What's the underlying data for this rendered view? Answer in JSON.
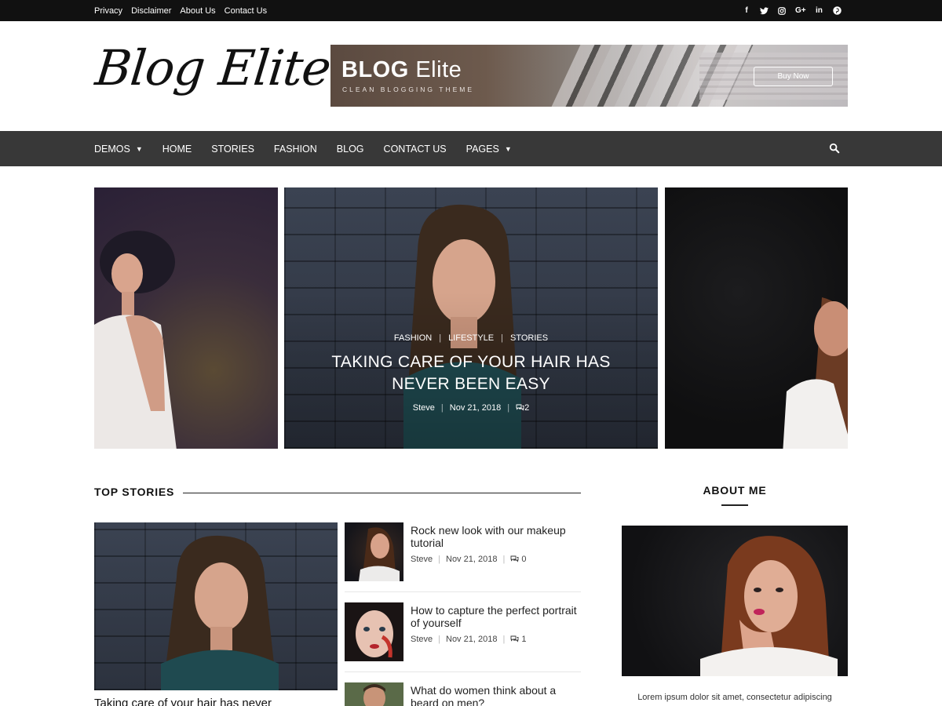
{
  "topbar": {
    "links": [
      "Privacy",
      "Disclaimer",
      "About Us",
      "Contact Us"
    ],
    "social_icons": [
      "facebook-icon",
      "twitter-icon",
      "instagram-icon",
      "google-plus-icon",
      "linkedin-icon",
      "pinterest-icon"
    ],
    "social_glyphs": [
      "f",
      "t",
      "◎",
      "G+",
      "in",
      "℗"
    ]
  },
  "header": {
    "logo": "Blog Elite",
    "banner": {
      "title_bold": "BLOG",
      "title_thin": "Elite",
      "subtitle": "CLEAN BLOGGING THEME",
      "button": "Buy Now"
    }
  },
  "nav": {
    "items": [
      {
        "label": "DEMOS",
        "dropdown": true
      },
      {
        "label": "HOME",
        "dropdown": false
      },
      {
        "label": "STORIES",
        "dropdown": false
      },
      {
        "label": "FASHION",
        "dropdown": false
      },
      {
        "label": "BLOG",
        "dropdown": false
      },
      {
        "label": "CONTACT US",
        "dropdown": false
      },
      {
        "label": "PAGES",
        "dropdown": true
      }
    ],
    "search_icon": "search-icon"
  },
  "hero": {
    "categories": [
      "FASHION",
      "LIFESTYLE",
      "STORIES"
    ],
    "title_line1": "TAKING CARE OF YOUR HAIR HAS",
    "title_line2": "NEVER BEEN EASY",
    "author": "Steve",
    "date": "Nov 21, 2018",
    "comments": "2"
  },
  "top_stories": {
    "heading": "TOP STORIES",
    "featured_caption": "Taking care of your hair has never",
    "items": [
      {
        "title": "Rock new look with our makeup tutorial",
        "author": "Steve",
        "date": "Nov 21, 2018",
        "comments": "0"
      },
      {
        "title": "How to capture the perfect portrait of yourself",
        "author": "Steve",
        "date": "Nov 21, 2018",
        "comments": "1"
      },
      {
        "title": "What do women think about a beard on men?",
        "author": "",
        "date": "",
        "comments": ""
      }
    ]
  },
  "about": {
    "heading": "ABOUT ME",
    "text": "Lorem ipsum dolor sit amet, consectetur adipiscing"
  },
  "colors": {
    "topbar_bg": "#111111",
    "nav_bg": "#383838",
    "text_dark": "#222222"
  }
}
